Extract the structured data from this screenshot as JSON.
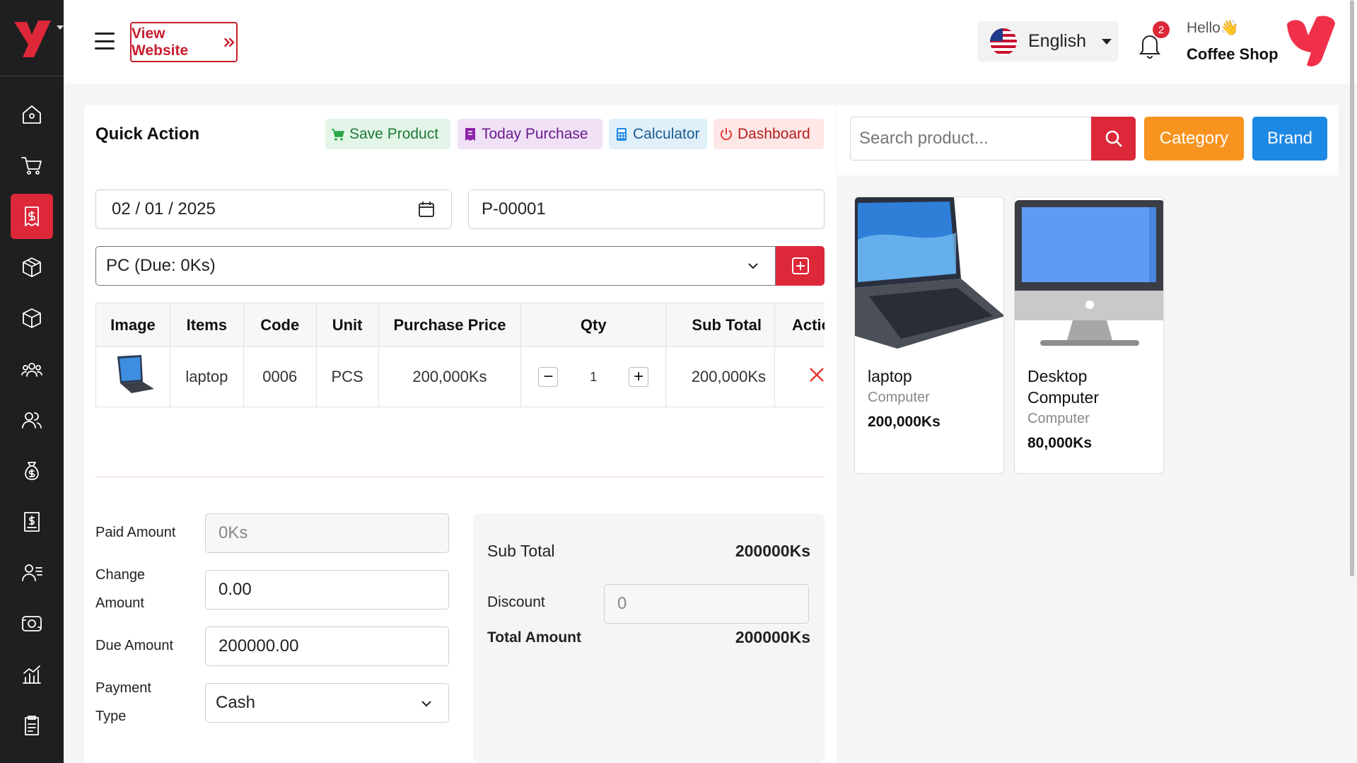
{
  "colors": {
    "brand": "#dc2839",
    "sidebar": "#1f1f1f",
    "category": "#f7931e",
    "brand_button": "#1e88e5"
  },
  "sidebar": {
    "items": [
      {
        "icon": "home-icon"
      },
      {
        "icon": "cart-icon"
      },
      {
        "icon": "purchase-receipt-icon",
        "active": true
      },
      {
        "icon": "box-icon"
      },
      {
        "icon": "package-icon"
      },
      {
        "icon": "users-group-icon"
      },
      {
        "icon": "users-icon"
      },
      {
        "icon": "money-bag-icon"
      },
      {
        "icon": "invoice-icon"
      },
      {
        "icon": "user-list-icon"
      },
      {
        "icon": "money-icon"
      },
      {
        "icon": "chart-icon"
      },
      {
        "icon": "clipboard-icon"
      }
    ]
  },
  "header": {
    "view_website": "View Website",
    "language": "English",
    "notifications": "2",
    "hello": "Hello👋",
    "shop_name": "Coffee Shop"
  },
  "quick_action": {
    "title": "Quick Action",
    "save_product": "Save Product",
    "today_purchase": "Today Purchase",
    "calculator": "Calculator",
    "dashboard": "Dashboard"
  },
  "form": {
    "date": "02 / 01 / 2025",
    "reference": "P-00001",
    "supplier": "PC (Due: 0Ks)"
  },
  "table": {
    "headers": [
      "Image",
      "Items",
      "Code",
      "Unit",
      "Purchase Price",
      "Qty",
      "Sub Total",
      "Action"
    ],
    "rows": [
      {
        "item": "laptop",
        "code": "0006",
        "unit": "PCS",
        "price": "200,000Ks",
        "qty": "1",
        "subtotal": "200,000Ks"
      }
    ]
  },
  "payment": {
    "paid_label": "Paid Amount",
    "paid_value": "0Ks",
    "change_label_1": "Change",
    "change_label_2": "Amount",
    "change_value": "0.00",
    "due_label": "Due Amount",
    "due_value": "200000.00",
    "type_label_1": "Payment",
    "type_label_2": "Type",
    "type_value": "Cash"
  },
  "summary": {
    "subtotal_label": "Sub Total",
    "subtotal_value": "200000Ks",
    "discount_label": "Discount",
    "discount_value": "0",
    "total_label": "Total Amount",
    "total_value": "200000Ks"
  },
  "products_panel": {
    "search_placeholder": "Search product...",
    "category": "Category",
    "brand": "Brand",
    "products": [
      {
        "name": "laptop",
        "category": "Computer",
        "price": "200,000Ks"
      },
      {
        "name": "Desktop Computer",
        "category": "Computer",
        "price": "80,000Ks"
      }
    ]
  }
}
